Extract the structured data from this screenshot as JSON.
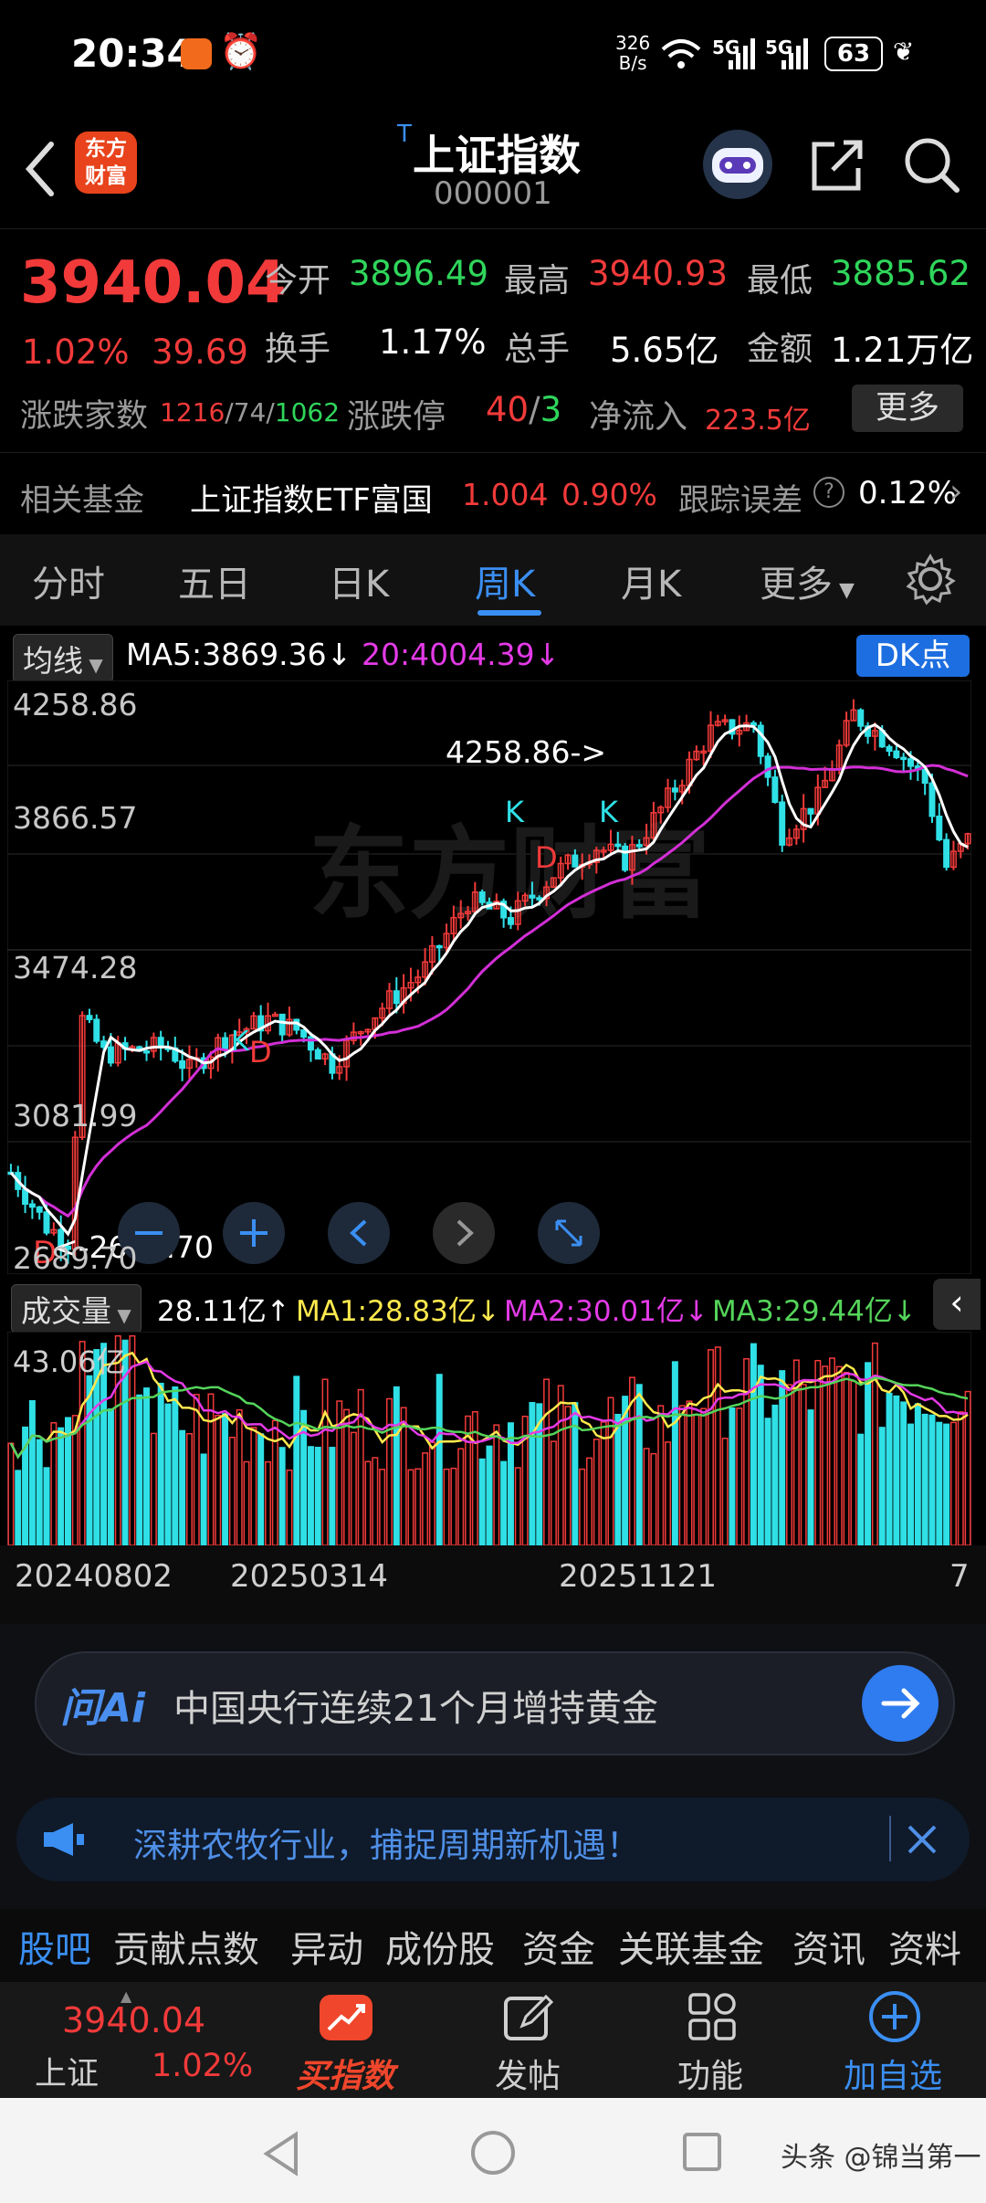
{
  "status": {
    "time": "20:34",
    "net_speed": "326",
    "net_unit": "B/s",
    "battery": "63",
    "sig1": "5G",
    "sig2": "5G"
  },
  "header": {
    "title": "上证指数",
    "code": "000001",
    "title_mark": "T",
    "logo_line1": "东方",
    "logo_line2": "财富"
  },
  "quote": {
    "price": "3940.04",
    "pct": "1.02%",
    "chg": "39.69",
    "open_label": "今开",
    "open": "3896.49",
    "high_label": "最高",
    "high": "3940.93",
    "low_label": "最低",
    "low": "3885.62",
    "turnover_label": "换手",
    "turnover": "1.17%",
    "volume_label": "总手",
    "volume": "5.65亿",
    "amount_label": "金额",
    "amount": "1.21万亿",
    "breadth_label": "涨跌家数",
    "breadth_up": "1216",
    "breadth_flat": "74",
    "breadth_down": "1062",
    "limit_label": "涨跌停",
    "limit_up": "40",
    "limit_down": "3",
    "inflow_label": "净流入",
    "inflow": "223.5亿",
    "more": "更多"
  },
  "fund": {
    "label": "相关基金",
    "name": "上证指数ETF富国",
    "price": "1.004",
    "pct": "0.90%",
    "track_label": "跟踪误差",
    "track": "0.12%"
  },
  "tabs": [
    "分时",
    "五日",
    "日K",
    "周K",
    "月K",
    "更多"
  ],
  "ma": {
    "chip": "均线",
    "ma5": "MA5:3869.36↓",
    "ma20": "20:4004.39↓",
    "dk": "DK点"
  },
  "yaxis": [
    "4258.86",
    "3866.57",
    "3474.28",
    "3081.99",
    "2689.70"
  ],
  "kannot": {
    "high": "4258.86->",
    "low": "<-2689.70",
    "k": "K",
    "d": "D"
  },
  "vol": {
    "chip": "成交量",
    "val": "28.11亿↑",
    "ma1": "MA1:28.83亿↓",
    "ma2": "MA2:30.01亿↓",
    "ma3": "MA3:29.44亿↓",
    "top": "43.06亿"
  },
  "xaxis": [
    "20240802",
    "20250314",
    "20251121",
    "7"
  ],
  "ai": {
    "brand": "问Ai",
    "text": "中国央行连续21个月增持黄金"
  },
  "notice": {
    "text": "深耕农牧行业，捕捉周期新机遇！"
  },
  "btabs": [
    "股吧",
    "贡献点数",
    "异动",
    "成份股",
    "资金",
    "关联基金",
    "资讯",
    "资料"
  ],
  "toolbar": {
    "mini_price": "3940.04",
    "mini_name": "上证",
    "mini_pct": "1.02%",
    "buy": "买指数",
    "post": "发帖",
    "func": "功能",
    "add": "加自选"
  },
  "watermark": "头条 @锦当第一",
  "colors": {
    "up": "#f23a3a",
    "down": "#2fe0e6",
    "accent": "#3b8ff3"
  }
}
